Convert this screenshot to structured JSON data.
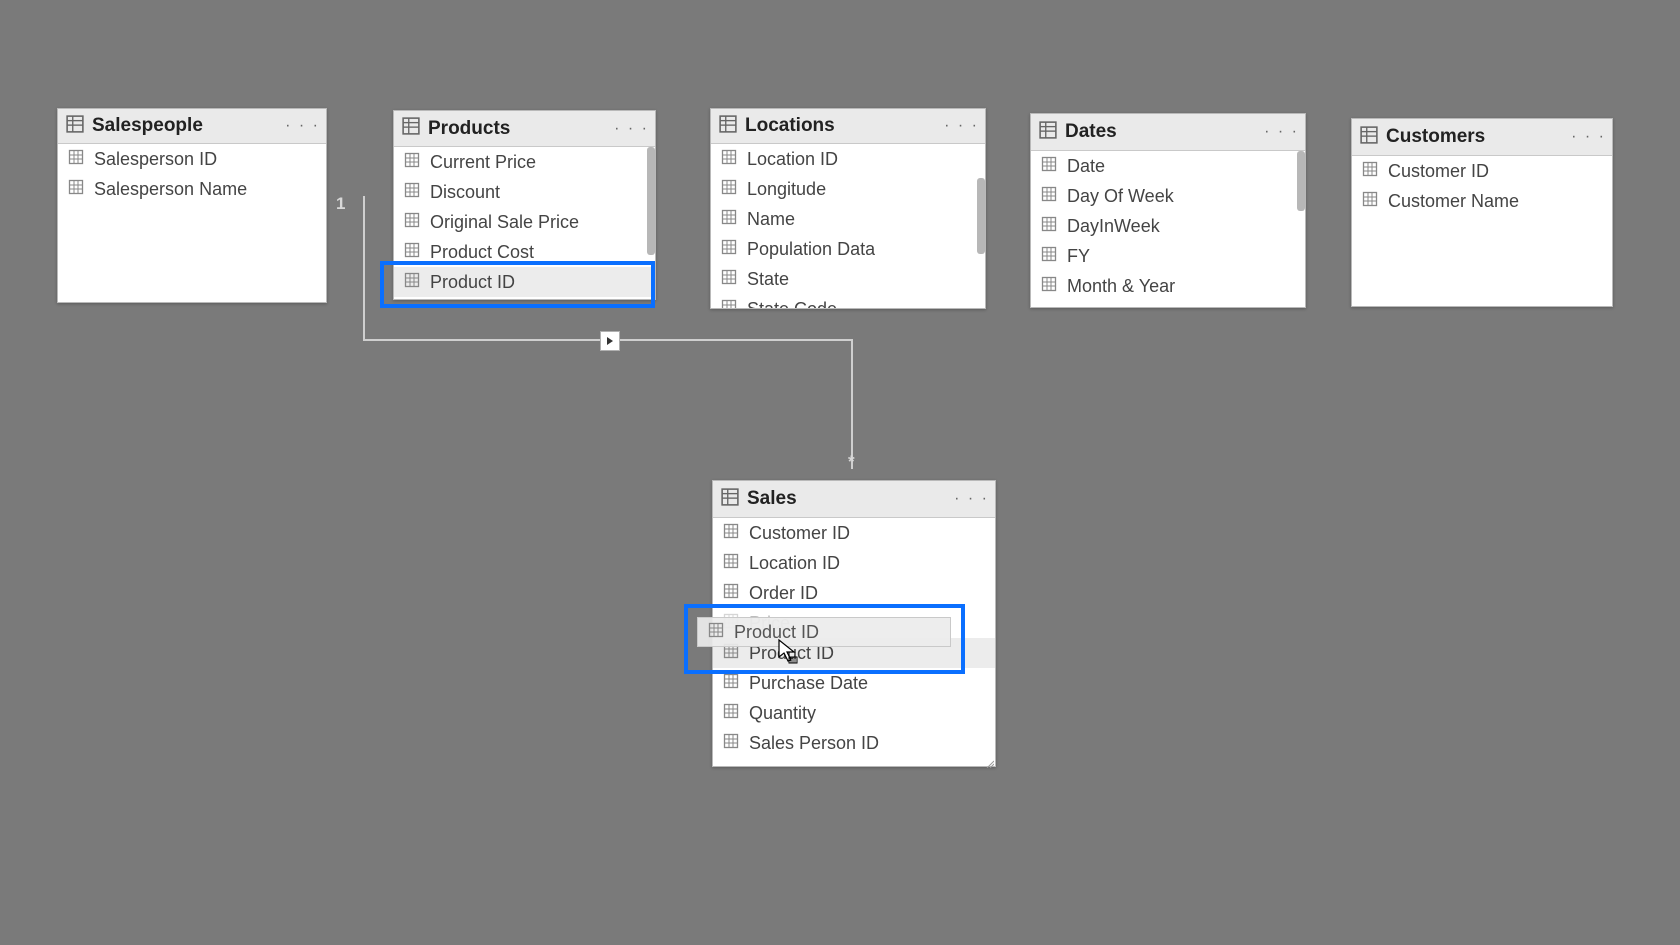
{
  "ellipsis": "· · ·",
  "relationship": {
    "from_cardinality": "1",
    "to_cardinality": "*"
  },
  "ghost": {
    "label": "Product ID"
  },
  "tables": {
    "salespeople": {
      "title": "Salespeople",
      "fields": [
        "Salesperson ID",
        "Salesperson Name"
      ]
    },
    "products": {
      "title": "Products",
      "fields": [
        "Current Price",
        "Discount",
        "Original Sale Price",
        "Product Cost",
        "Product ID"
      ]
    },
    "locations": {
      "title": "Locations",
      "fields": [
        "Location ID",
        "Longitude",
        "Name",
        "Population Data",
        "State",
        "State Code"
      ]
    },
    "dates": {
      "title": "Dates",
      "fields": [
        "Date",
        "Day Of Week",
        "DayInWeek",
        "FY",
        "Month & Year"
      ]
    },
    "customers": {
      "title": "Customers",
      "fields": [
        "Customer ID",
        "Customer Name"
      ]
    },
    "sales": {
      "title": "Sales",
      "fields": [
        "Customer ID",
        "Location ID",
        "Order ID",
        "Price",
        "Product ID",
        "Purchase Date",
        "Quantity",
        "Sales Person ID"
      ]
    }
  }
}
